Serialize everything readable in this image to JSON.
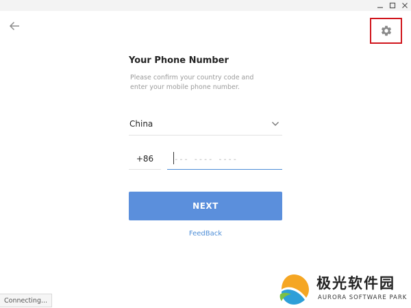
{
  "window": {
    "controls": [
      "minimize",
      "maximize",
      "close"
    ]
  },
  "nav": {
    "back_icon": "arrow-left-icon",
    "settings_icon": "gear-icon",
    "settings_highlight_color": "#d0141b"
  },
  "login": {
    "title": "Your Phone Number",
    "description_line1": "Please confirm your country code and",
    "description_line2": "enter your mobile phone number.",
    "country": "China",
    "country_code": "+86",
    "phone_placeholder": "--- ---- ----",
    "phone_value": "",
    "next_label": "NEXT",
    "feedback_label": "FeedBack"
  },
  "status": {
    "text": "Connecting..."
  },
  "watermark": {
    "title": "极光软件园",
    "subtitle": "AURORA SOFTWARE PARK"
  },
  "colors": {
    "accent": "#5b8fdc",
    "link": "#4a8bd6",
    "highlight_border": "#d0141b"
  }
}
